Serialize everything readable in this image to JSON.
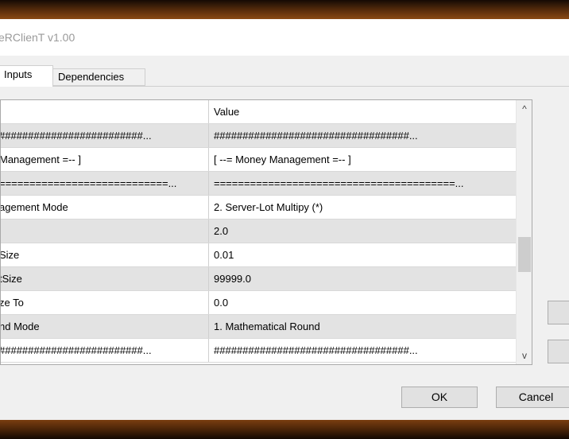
{
  "window": {
    "title": "eRClienT v1.00"
  },
  "tabs": [
    {
      "label": "Inputs",
      "active": true
    },
    {
      "label": "Dependencies",
      "active": false
    }
  ],
  "grid": {
    "header": {
      "name": "",
      "value": "Value"
    },
    "rows": [
      {
        "name": "#########################...",
        "value": "##################################..."
      },
      {
        "name": "Management =-- ]",
        "value": "[ --= Money Management =-- ]"
      },
      {
        "name": "============================...",
        "value": "========================================..."
      },
      {
        "name": "agement Mode",
        "value": "2. Server-Lot Multipy (*)"
      },
      {
        "name": "",
        "value": "2.0"
      },
      {
        "name": "Size",
        "value": "0.01"
      },
      {
        "name": "tSize",
        "value": "99999.0"
      },
      {
        "name": "ze To",
        "value": "0.0"
      },
      {
        "name": "nd Mode",
        "value": "1. Mathematical Round"
      },
      {
        "name": "#########################...",
        "value": "##################################..."
      }
    ]
  },
  "scrollbar": {
    "up_icon": "^",
    "down_icon": "v"
  },
  "buttons": {
    "ok": "OK",
    "cancel": "Cancel"
  },
  "colors": {
    "row_alt": "#e3e3e3",
    "grid_border": "#a9a9a9",
    "backdrop": "#8a4a14"
  }
}
